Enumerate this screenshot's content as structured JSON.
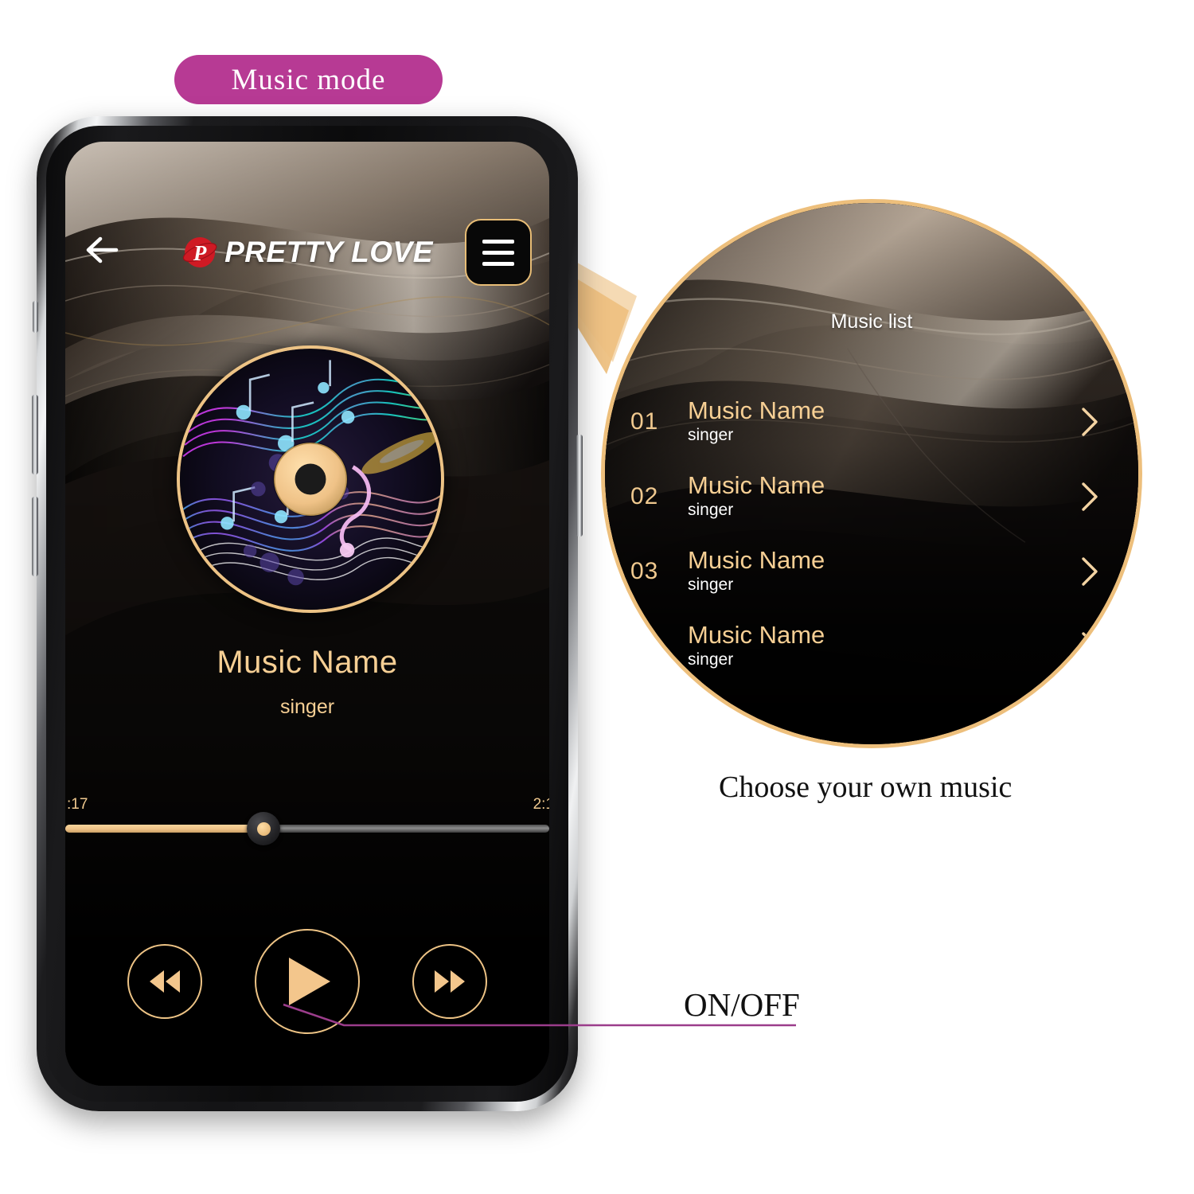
{
  "badge": {
    "label": "Music mode"
  },
  "phone": {
    "header": {
      "back_icon": "back-arrow-icon",
      "brand": "PRETTY LOVE",
      "menu_icon": "hamburger-menu-icon"
    },
    "album_art": {
      "icon": "music-disc-icon"
    },
    "now_playing": {
      "title": "Music Name",
      "artist": "singer"
    },
    "progress": {
      "elapsed": ":17",
      "duration": "2:1",
      "percent": 41
    },
    "controls": {
      "previous_label": "rewind-icon",
      "play_label": "play-icon",
      "next_label": "fast-forward-icon"
    }
  },
  "magnifier": {
    "title": "Music list",
    "tracks": [
      {
        "num": "01",
        "name": "Music Name",
        "singer": "singer"
      },
      {
        "num": "02",
        "name": "Music Name",
        "singer": "singer"
      },
      {
        "num": "03",
        "name": "Music Name",
        "singer": "singer"
      },
      {
        "num": "",
        "name": "Music Name",
        "singer": "singer"
      }
    ]
  },
  "captions": {
    "music": "Choose your own music",
    "onoff": "ON/OFF"
  },
  "colors": {
    "badge_bg": "#b73a94",
    "gold": "#edc385",
    "gold_text": "#f6cf94",
    "leader_purple": "#9b3d8b",
    "cone_gold": "#eec182"
  }
}
